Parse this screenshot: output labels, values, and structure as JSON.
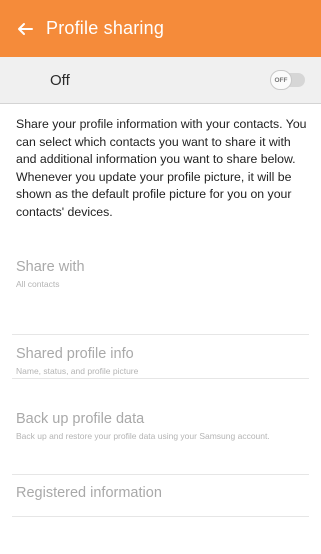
{
  "header": {
    "title": "Profile sharing",
    "back_icon": "arrow-left-icon",
    "background": "#f58b3a"
  },
  "master_switch": {
    "label": "Off",
    "toggle_text": "OFF",
    "state": "off"
  },
  "description": "Share your profile information with your contacts. You can select which contacts you want to share it with and additional information you want to share below. Whenever you update your profile picture, it will be shown as the default profile picture for you on your contacts' devices.",
  "items": [
    {
      "title": "Share with",
      "subtitle": "All contacts"
    },
    {
      "title": "Shared profile info",
      "subtitle": "Name, status, and profile picture"
    },
    {
      "title": "Back up profile data",
      "subtitle": "Back up and restore your profile data using your Samsung account."
    },
    {
      "title": "Registered information",
      "subtitle": ""
    }
  ]
}
